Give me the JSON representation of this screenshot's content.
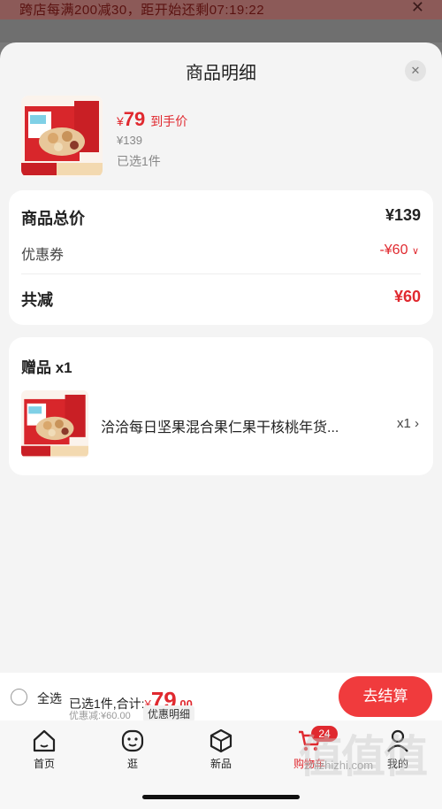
{
  "promo": {
    "text": "跨店每满200减30，距开始还剩07:19:22",
    "close_icon": "close-icon"
  },
  "sheet": {
    "title": "商品明细",
    "close_icon": "close-icon",
    "product": {
      "image_icon": "product-image",
      "price_symbol": "¥",
      "price": "79",
      "price_tag": "到手价",
      "original_price": "¥139",
      "selected": "已选1件"
    },
    "summary": {
      "total_label": "商品总价",
      "total_value": "¥139",
      "coupon_label": "优惠券",
      "coupon_value": "-¥60",
      "coupon_icon": "chevron-down-icon",
      "saved_label": "共减",
      "saved_value": "¥60"
    },
    "gift": {
      "header": "赠品 x1",
      "name": "洽洽每日坚果混合果仁果干核桃年货...",
      "qty": "x1",
      "chevron_icon": "chevron-right-icon"
    }
  },
  "checkout": {
    "select_all": "全选",
    "summary_prefix": "已选1件,合计:",
    "total_symbol": "¥",
    "total_int": "79",
    "total_dec": ".00",
    "discount": "优惠减:¥60.00",
    "detail_link": "优惠明细",
    "button": "去结算"
  },
  "tabbar": {
    "tabs": [
      {
        "label": "首页",
        "icon": "home-icon"
      },
      {
        "label": "逛",
        "icon": "face-icon"
      },
      {
        "label": "新品",
        "icon": "box-icon"
      },
      {
        "label": "购物车",
        "icon": "cart-icon"
      },
      {
        "label": "我的",
        "icon": "user-icon"
      }
    ],
    "cart_badge": "24"
  },
  "watermark": {
    "text": "zhizhizhi.com",
    "logo": "值值值"
  },
  "colors": {
    "accent": "#e0292f",
    "button": "#f03b3d",
    "sheet_bg": "#f4f4f4"
  }
}
